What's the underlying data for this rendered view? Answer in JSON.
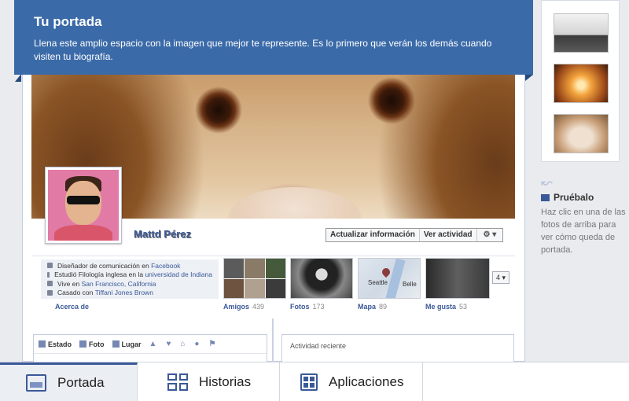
{
  "banner": {
    "title": "Tu portada",
    "description": "Llena este amplio espacio con la imagen que mejor te represente. Es lo primero que verán los demás cuando visiten tu biografía."
  },
  "profile": {
    "name": "Mattd Pérez",
    "update_info_label": "Actualizar información",
    "view_activity_label": "Ver actividad",
    "settings_label": "⚙ ▾"
  },
  "info": {
    "line1_prefix": "Diseñador de comunicación en",
    "line1_link": "Facebook",
    "line2_prefix": "Estudió Filología inglesa en la",
    "line2_link": "universidad de Indiana",
    "line3_prefix": "Vive en",
    "line3_link": "San Francisco, California",
    "line4_prefix": "Casado con",
    "line4_link": "Tiffani Jones Brown",
    "about_label": "Acerca de"
  },
  "tiles": [
    {
      "label": "Amigos",
      "count": "439"
    },
    {
      "label": "Fotos",
      "count": "173"
    },
    {
      "label": "Mapa",
      "count": "89"
    },
    {
      "label": "Me gusta",
      "count": "53"
    }
  ],
  "map": {
    "city1": "Seattle",
    "city2": "Belle"
  },
  "more_button": "4 ▾",
  "composer": {
    "tab_status": "Estado",
    "tab_photo": "Foto",
    "tab_place": "Lugar"
  },
  "activity": {
    "title": "Actividad reciente"
  },
  "side": {
    "try_title": "Pruébalo",
    "try_text": "Haz clic en una de las fotos de arriba para ver cómo queda de portada."
  },
  "nav": {
    "tab_cover": "Portada",
    "tab_stories": "Historias",
    "tab_apps": "Aplicaciones"
  },
  "colors": {
    "brand": "#3b5998",
    "banner": "#3b6aa8"
  }
}
